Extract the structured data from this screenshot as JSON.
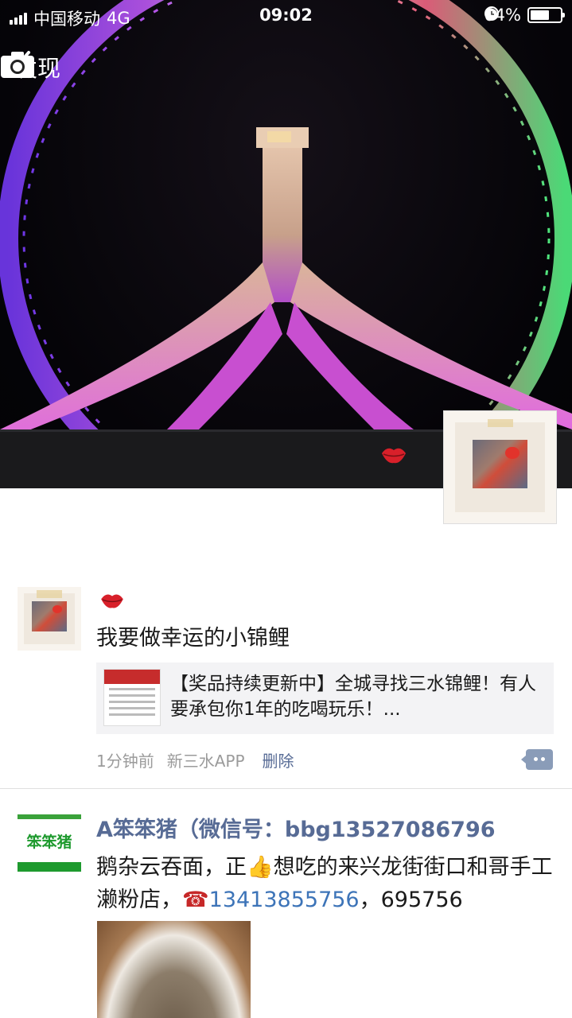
{
  "status_bar": {
    "carrier": "中国移动",
    "network": "4G",
    "time": "09:02",
    "battery": "64%",
    "battery_level": 0.64
  },
  "nav": {
    "back_label": "发现",
    "back_icon": "chevron-left-icon",
    "camera_icon": "camera-icon"
  },
  "posts": [
    {
      "lips_icon": "lips-icon",
      "text": "我要做幸运的小锦鲤",
      "share": {
        "title": "【奖品持续更新中】全城寻找三水锦鲤！有人要承包你1年的吃喝玩乐！..."
      },
      "time": "1分钟前",
      "source": "新三水APP",
      "delete_label": "删除"
    },
    {
      "name": "A笨笨猪（微信号：bbg13527086796",
      "text_part1": "鹅杂云吞面，正",
      "emoji_thumb": "👍",
      "text_part2": "想吃的来兴龙街街口和哥手工濑粉店，",
      "emoji_phone": "☎",
      "phone": "13413855756",
      "text_part3": "，695756",
      "logo_text": "笨笨猪"
    }
  ],
  "colors": {
    "name_link": "#576b95",
    "phone_link": "#3d74b8",
    "meta_gray": "#9b9b9b"
  }
}
